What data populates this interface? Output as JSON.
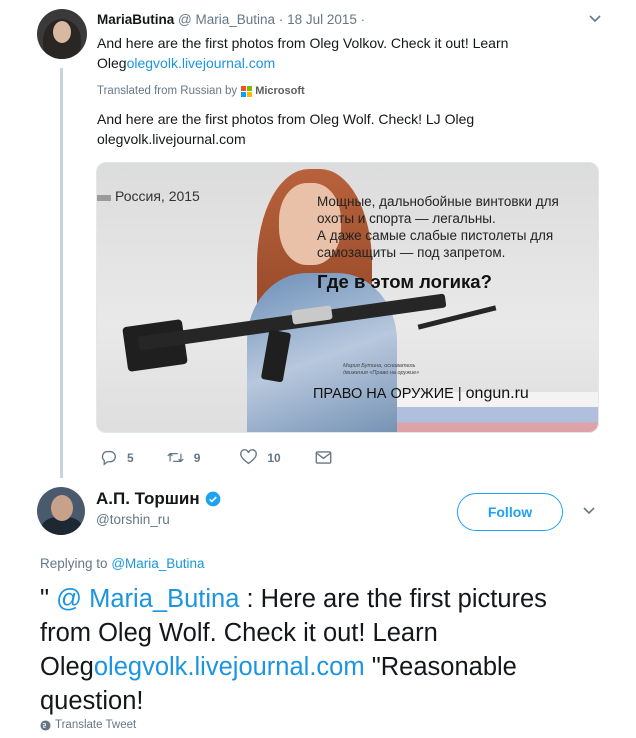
{
  "tweet1": {
    "author_name": "MariaButina",
    "handle": "@ Maria_Butina",
    "dot": "·",
    "date": "18 Jul 2015",
    "dot2": "·",
    "text_prefix": "And here are the first photos from Oleg Volkov. Check it out! Learn Oleg",
    "text_link": "olegvolk.livejournal.com",
    "translated_label": "Translated from Russian by",
    "translator": "Microsoft",
    "translator_colors": [
      "#f25022",
      "#7fba00",
      "#00a4ef",
      "#ffb900"
    ],
    "translation": "And here are the first photos from Oleg Wolf. Check! LJ Oleg olegvolk.livejournal.com",
    "poster": {
      "year": "Россия, 2015",
      "line1": "Мощные, дальнобойные винтовки для охоты и спорта — легальны.",
      "line2": "А даже самые слабые пистолеты для самозащиты — под запретом.",
      "question": "Где в этом логика?",
      "caption": "Мария Бутина, основатель движения «Право на оружие»",
      "footer_left": "ПРАВО НА ОРУЖИЕ",
      "footer_sep": "|",
      "footer_right": "ongun.ru"
    },
    "actions": {
      "reply_count": "5",
      "retweet_count": "9",
      "like_count": "10"
    }
  },
  "tweet2": {
    "author_name": "А.П. Торшин",
    "handle": "@torshin_ru",
    "follow_label": "Follow",
    "replying_label": "Replying to",
    "replying_handle": "@Maria_Butina",
    "text_quote_open": "\"",
    "text_mention": "@ Maria_Butina",
    "text_part1": ": Here are the first pictures from Oleg Wolf. Check it out! Learn Oleg",
    "text_link": "olegvolk.livejournal.com",
    "text_part2": "\"Reasonable question!",
    "translate_label": "Translate Tweet"
  },
  "colors": {
    "link": "#1b95e0",
    "accent": "#1da1f2",
    "muted": "#657786",
    "thread_line": "#c5d5e0"
  }
}
